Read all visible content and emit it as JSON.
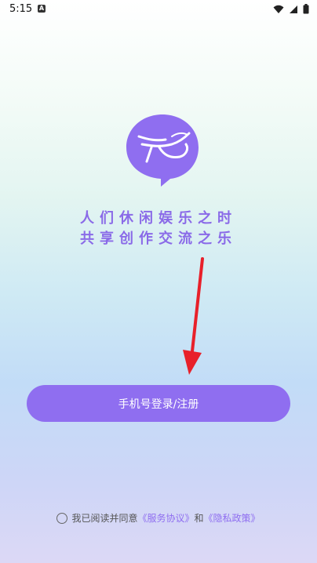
{
  "status_bar": {
    "time": "5:15",
    "notification_icon": "A",
    "icons": [
      "wifi-icon",
      "signal-icon",
      "battery-icon"
    ]
  },
  "logo": {
    "icon": "chat-bubble-brush-logo",
    "color": "#8f6ef0"
  },
  "slogan": {
    "line1": "人们休闲娱乐之时",
    "line2": "共享创作交流之乐"
  },
  "login_button": {
    "label": "手机号登录/注册",
    "color": "#8f6ef0"
  },
  "agreement": {
    "prefix": "我已阅读并同意",
    "service_link": "《服务协议》",
    "and": "和",
    "privacy_link": "《隐私政策》"
  },
  "annotation": {
    "arrow_color": "#e8202a"
  }
}
